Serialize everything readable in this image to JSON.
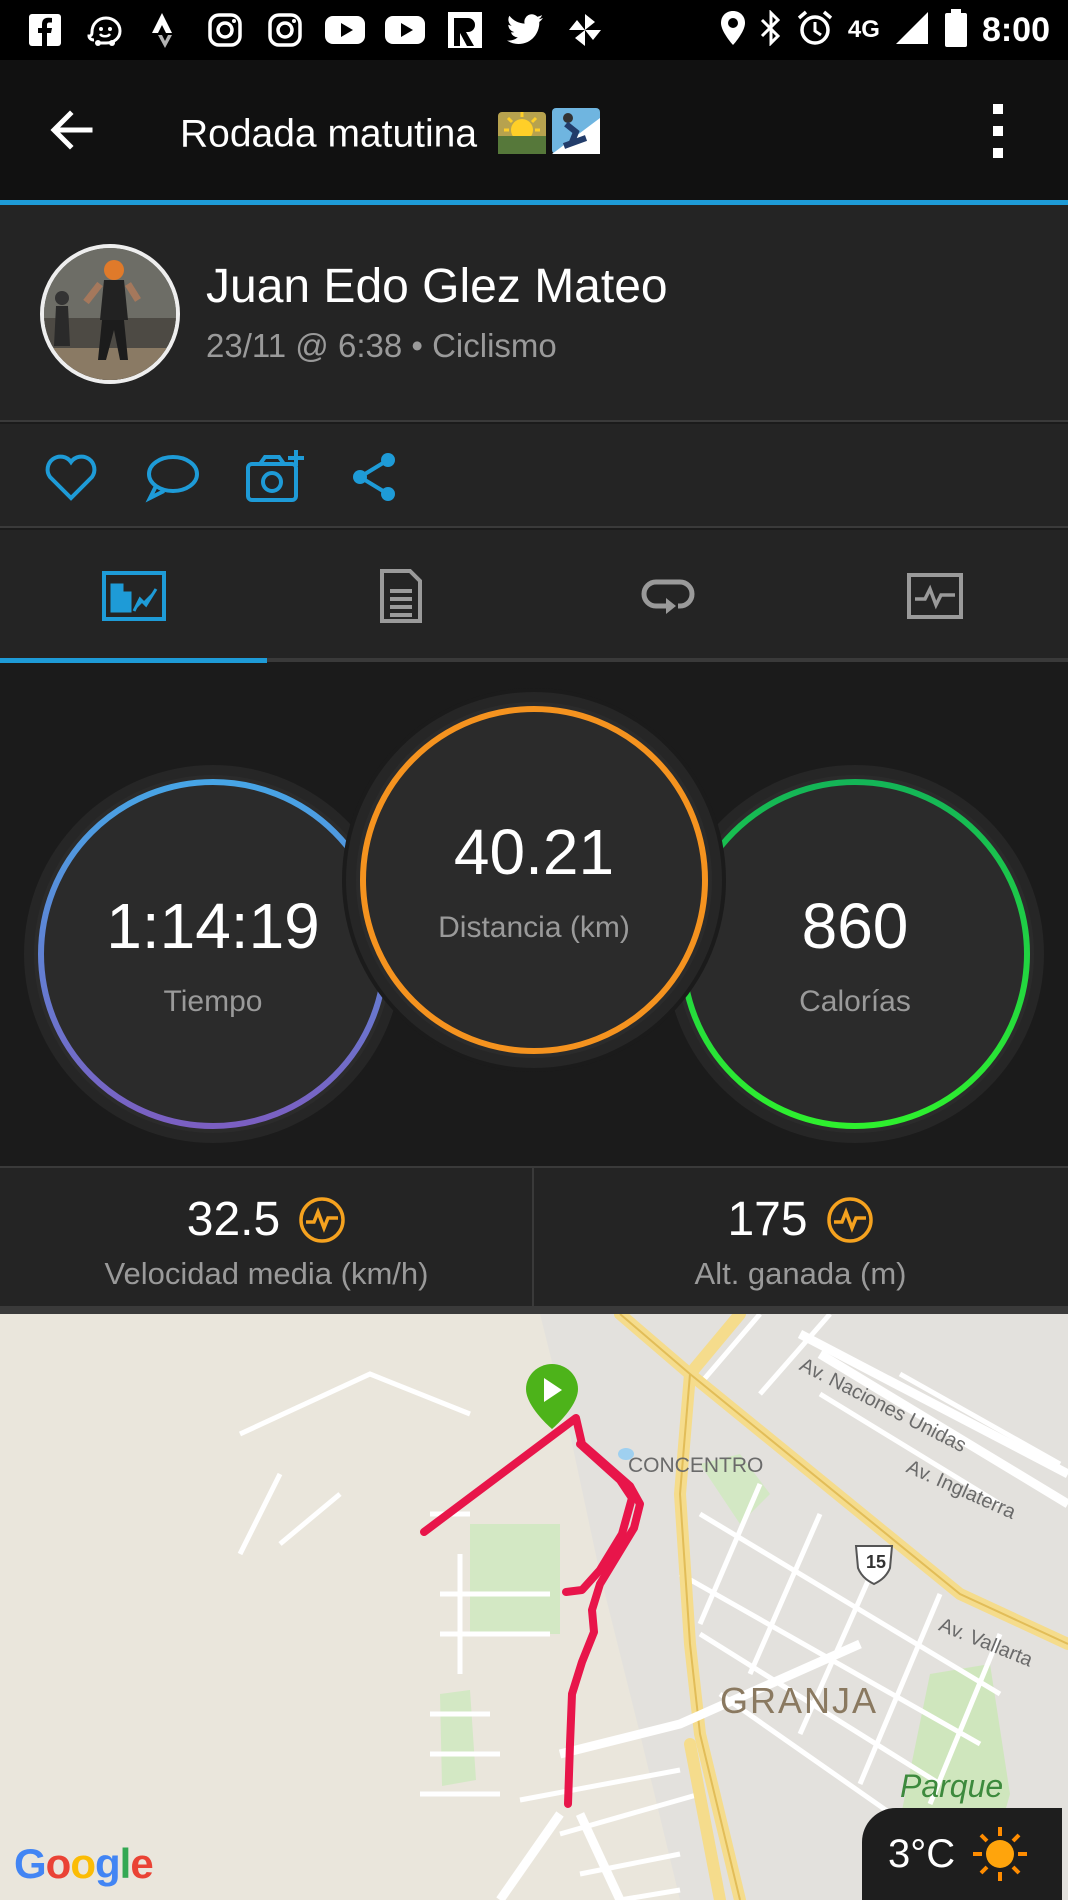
{
  "status_bar": {
    "time": "8:00",
    "network": "4G",
    "left_icons": [
      "facebook-icon",
      "waze-icon",
      "strava-icon",
      "instagram-icon",
      "instagram-icon",
      "youtube-icon",
      "youtube-icon",
      "runtastic-icon",
      "twitter-icon",
      "pinwheel-icon"
    ],
    "right_icons": [
      "location-icon",
      "bluetooth-icon",
      "alarm-icon",
      "signal-icon",
      "battery-icon"
    ]
  },
  "app_bar": {
    "title": "Rodada matutina",
    "title_emoji": "🌄🏂"
  },
  "activity": {
    "user_name": "Juan Edo Glez Mateo",
    "meta": "23/11 @ 6:38 • Ciclismo"
  },
  "actions": [
    "like-icon",
    "comment-icon",
    "add-photo-icon",
    "share-icon"
  ],
  "tabs": [
    {
      "icon": "stats-tab-icon",
      "active": true
    },
    {
      "icon": "details-tab-icon",
      "active": false
    },
    {
      "icon": "laps-tab-icon",
      "active": false
    },
    {
      "icon": "charts-tab-icon",
      "active": false
    }
  ],
  "stats": {
    "time": {
      "value": "1:14:19",
      "label": "Tiempo"
    },
    "distance": {
      "value": "40.21",
      "label": "Distancia (km)"
    },
    "calories": {
      "value": "860",
      "label": "Calorías"
    }
  },
  "metrics": {
    "speed": {
      "value": "32.5",
      "label": "Velocidad media (km/h)"
    },
    "elevation": {
      "value": "175",
      "label": "Alt. ganada (m)"
    }
  },
  "map": {
    "labels": {
      "naciones": "Av. Naciones Unidas",
      "inglaterra": "Av. Inglaterra",
      "vallarta": "Av. Vallarta",
      "concentro": "CONCENTRO",
      "granja": "GRANJA",
      "parque": "Parque",
      "route_shield": "15"
    },
    "weather_temp": "3°C",
    "google": "Google"
  },
  "colors": {
    "accent": "#1e9bd7",
    "time_ring": "#4aa3e0",
    "distance_ring": "#f5931f",
    "calories_ring": "#1fd14a",
    "route": "#e8154a",
    "metric_icon": "#f5a21f"
  }
}
